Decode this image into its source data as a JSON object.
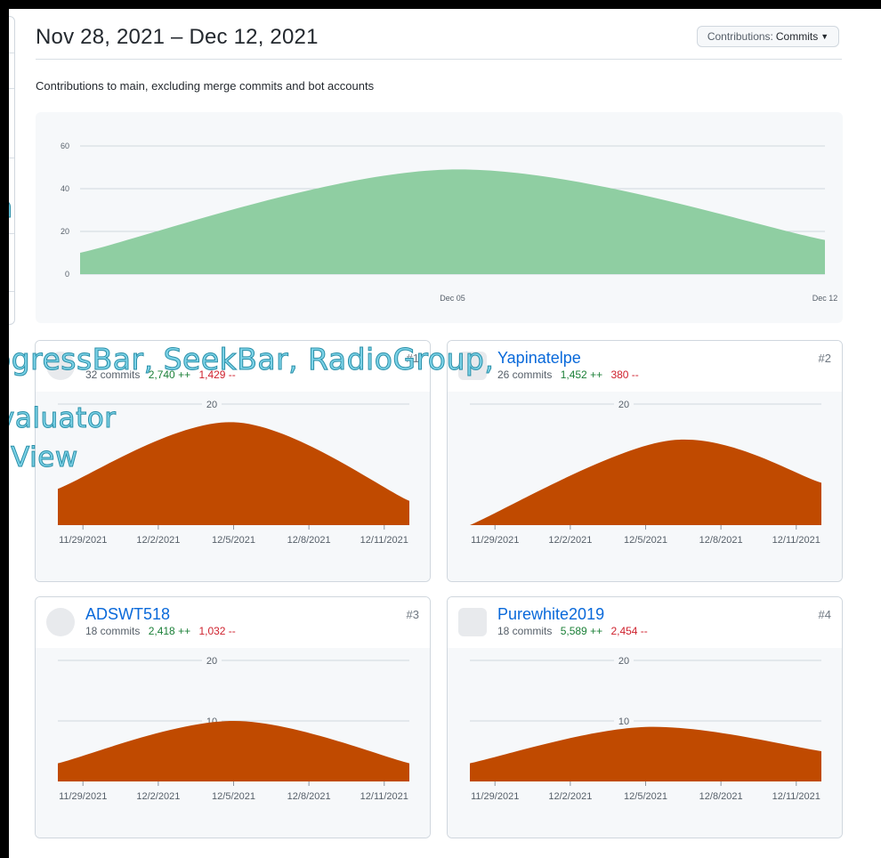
{
  "header": {
    "title": "Nov 28, 2021 – Dec 12, 2021",
    "dropdown_prefix": "Contributions:",
    "dropdown_value": "Commits",
    "subtitle": "Contributions to main, excluding merge commits and bot accounts"
  },
  "overlay": {
    "line1": "ogressBar, SeekBar, RadioGroup,",
    "line2": "valuator",
    "line3": "nView",
    "frag_n": "n",
    "frag_paren": ")"
  },
  "main_chart": {
    "y_ticks": [
      "0",
      "20",
      "40",
      "60"
    ],
    "x_ticks": [
      "Dec 05",
      "Dec 12"
    ],
    "fill_color": "#8fcea2"
  },
  "contributors": [
    {
      "name": "",
      "commits": "32 commits",
      "additions": "2,740 ++",
      "deletions": "1,429 --",
      "rank": "#1",
      "avatar_icon": "avatar-dark-portrait-icon"
    },
    {
      "name": "Yapinatelpe",
      "commits": "26 commits",
      "additions": "1,452 ++",
      "deletions": "380 --",
      "rank": "#2",
      "avatar_icon": "avatar-pink-identicon-icon"
    },
    {
      "name": "ADSWT518",
      "commits": "18 commits",
      "additions": "2,418 ++",
      "deletions": "1,032 --",
      "rank": "#3",
      "avatar_icon": "avatar-penguin-icon"
    },
    {
      "name": "Purewhite2019",
      "commits": "18 commits",
      "additions": "5,589 ++",
      "deletions": "2,454 --",
      "rank": "#4",
      "avatar_icon": "avatar-floppy-disk-icon"
    }
  ],
  "card_axis": {
    "x_ticks": [
      "11/29/2021",
      "12/2/2021",
      "12/5/2021",
      "12/8/2021",
      "12/11/2021"
    ],
    "y_ticks_a": [
      "20"
    ],
    "y_ticks_b": [
      "20",
      "10"
    ],
    "fill_color": "#c04a00"
  },
  "chart_data": [
    {
      "type": "area",
      "x_ticks": [
        "Dec 05",
        "Dec 12"
      ],
      "ylim": [
        0,
        60
      ],
      "y_ticks": [
        0,
        20,
        40,
        60
      ],
      "x": [
        "Nov 28",
        "Dec 05",
        "Dec 12"
      ],
      "series": [
        {
          "values": [
            10,
            49,
            16
          ]
        }
      ],
      "grid": true
    },
    {
      "type": "area",
      "x_ticks": [
        "11/29/2021",
        "12/2/2021",
        "12/5/2021",
        "12/8/2021",
        "12/11/2021"
      ],
      "y_ticks": [
        20
      ],
      "x": [
        "11/28/2021",
        "12/5/2021",
        "12/12/2021"
      ],
      "series": [
        {
          "values": [
            6,
            17,
            4
          ]
        }
      ]
    },
    {
      "type": "area",
      "x_ticks": [
        "11/29/2021",
        "12/2/2021",
        "12/5/2021",
        "12/8/2021",
        "12/11/2021"
      ],
      "y_ticks": [
        20
      ],
      "x": [
        "11/28/2021",
        "12/6/2021",
        "12/12/2021"
      ],
      "series": [
        {
          "values": [
            0,
            14,
            7
          ]
        }
      ]
    },
    {
      "type": "area",
      "x_ticks": [
        "11/29/2021",
        "12/2/2021",
        "12/5/2021",
        "12/8/2021",
        "12/11/2021"
      ],
      "y_ticks": [
        10,
        20
      ],
      "x": [
        "11/28/2021",
        "12/5/2021",
        "12/12/2021"
      ],
      "series": [
        {
          "values": [
            3,
            10,
            3
          ]
        }
      ]
    },
    {
      "type": "area",
      "x_ticks": [
        "11/29/2021",
        "12/2/2021",
        "12/5/2021",
        "12/8/2021",
        "12/11/2021"
      ],
      "y_ticks": [
        10,
        20
      ],
      "x": [
        "11/28/2021",
        "12/5/2021",
        "12/12/2021"
      ],
      "series": [
        {
          "values": [
            3,
            9,
            5
          ]
        }
      ]
    }
  ]
}
